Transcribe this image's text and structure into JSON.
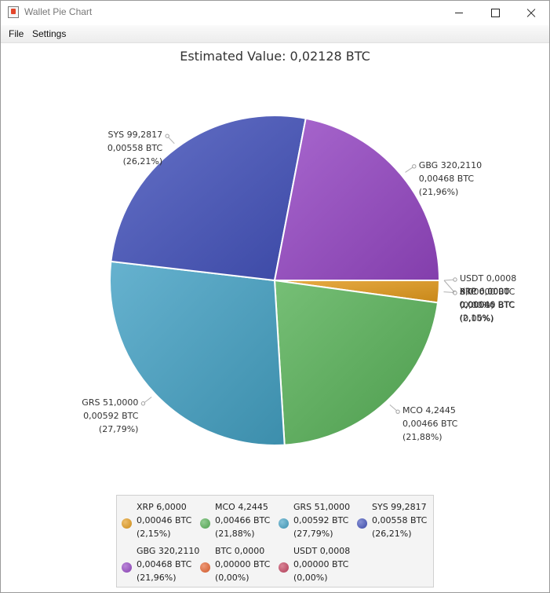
{
  "window": {
    "title": "Wallet Pie Chart"
  },
  "menu": {
    "file": "File",
    "settings": "Settings"
  },
  "chart_data": {
    "type": "pie",
    "title": "Estimated Value: 0,02128 BTC",
    "slices": [
      {
        "name": "XRP 6,0000",
        "value": 0.00046,
        "value_label": "0,00046 BTC",
        "percent_label": "(2,15%)",
        "color": "#e39a1c"
      },
      {
        "name": "MCO 4,2445",
        "value": 0.00466,
        "value_label": "0,00466 BTC",
        "percent_label": "(21,88%)",
        "color": "#58b158"
      },
      {
        "name": "GRS 51,0000",
        "value": 0.00592,
        "value_label": "0,00592 BTC",
        "percent_label": "(27,79%)",
        "color": "#44a1c4"
      },
      {
        "name": "SYS 99,2817",
        "value": 0.00558,
        "value_label": "0,00558 BTC",
        "percent_label": "(26,21%)",
        "color": "#4352bb"
      },
      {
        "name": "GBG 320,2110",
        "value": 0.00468,
        "value_label": "0,00468 BTC",
        "percent_label": "(21,96%)",
        "color": "#9546c3"
      },
      {
        "name": "BTC 0,0000",
        "value": 0.0,
        "value_label": "0,00000 BTC",
        "percent_label": "(0,00%)",
        "color": "#e5622f"
      },
      {
        "name": "USDT 0,0008",
        "value": 0.0,
        "value_label": "0,00000 BTC",
        "percent_label": "(0,00%)",
        "color": "#c4435f"
      }
    ],
    "legend_position": "bottom"
  }
}
